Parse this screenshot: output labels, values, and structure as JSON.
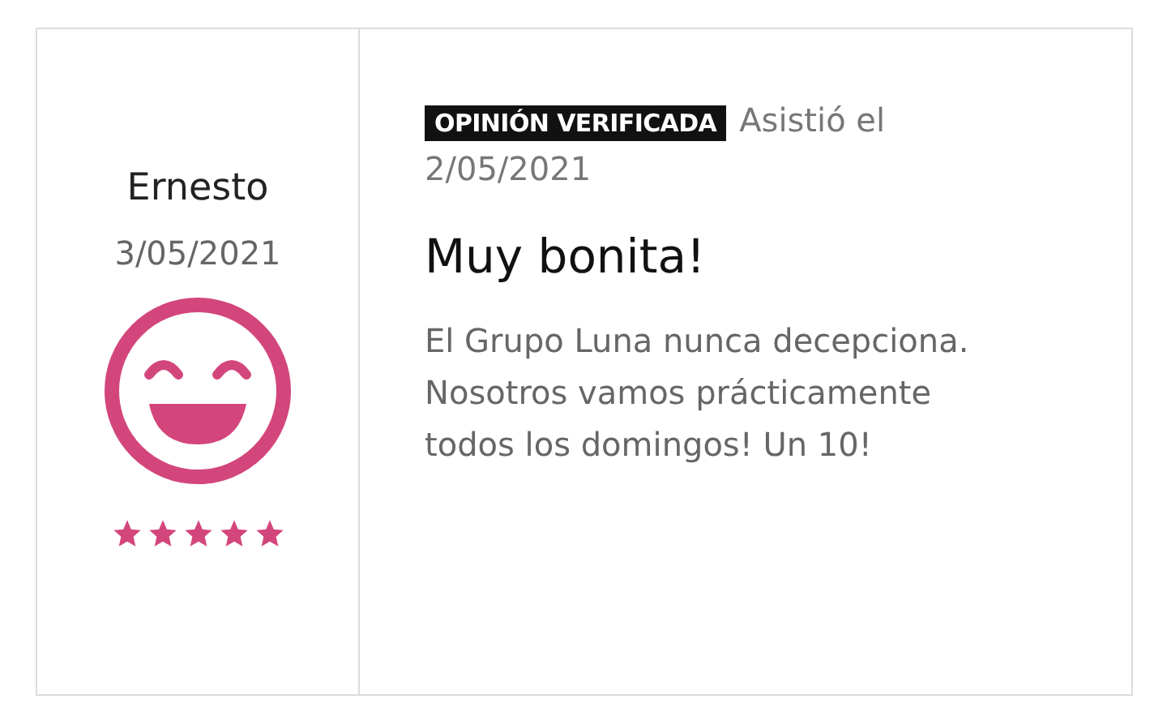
{
  "review": {
    "author": "Ernesto",
    "date": "3/05/2021",
    "stars": 5,
    "badge": "OPINIÓN VERIFICADA",
    "attended_label": "Asistió el",
    "attended_date": "2/05/2021",
    "title": "Muy bonita!",
    "body": "El Grupo Luna nunca decepciona. Nosotros vamos prácticamente todos los domingos! Un 10!"
  }
}
